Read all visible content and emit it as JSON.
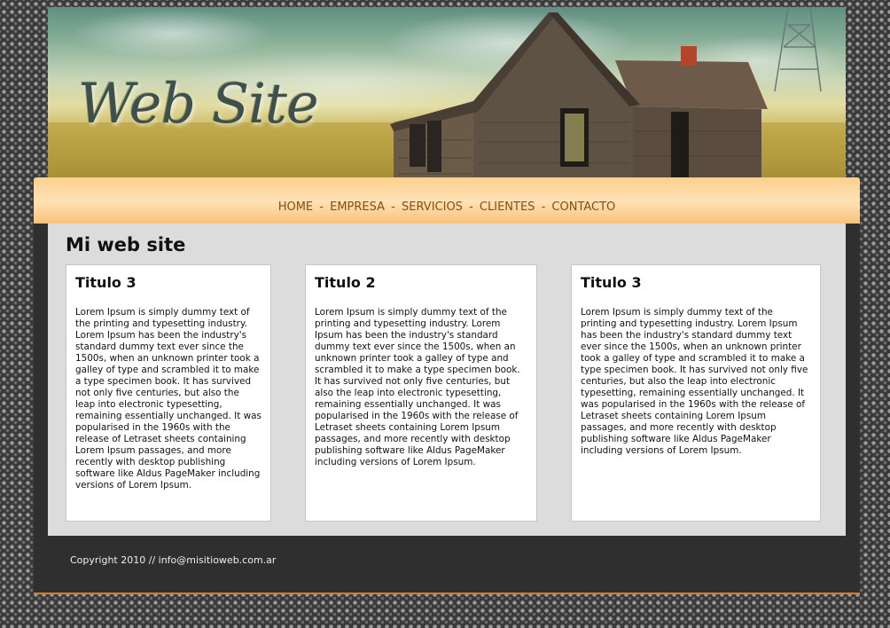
{
  "header": {
    "logo_text": "Web Site",
    "image": "abandoned-house-in-field-image"
  },
  "nav": {
    "items": [
      "HOME",
      "EMPRESA",
      "SERVICIOS",
      "CLIENTES",
      "CONTACTO"
    ],
    "separator": "-"
  },
  "main": {
    "title": "Mi web site",
    "columns": [
      {
        "heading": "Titulo 3",
        "text": "Lorem Ipsum is simply dummy text of the printing and typesetting industry. Lorem Ipsum has been the industry's standard dummy text ever since the 1500s, when an unknown printer took a galley of type and scrambled it to make a type specimen book. It has survived not only five centuries, but also the leap into electronic typesetting, remaining essentially unchanged. It was popularised in the 1960s with the release of Letraset sheets containing Lorem Ipsum passages, and more recently with desktop publishing software like Aldus PageMaker including versions of Lorem Ipsum."
      },
      {
        "heading": "Titulo 2",
        "text": "Lorem Ipsum is simply dummy text of the printing and typesetting industry. Lorem Ipsum has been the industry's standard dummy text ever since the 1500s, when an unknown printer took a galley of type and scrambled it to make a type specimen book. It has survived not only five centuries, but also the leap into electronic typesetting, remaining essentially unchanged. It was popularised in the 1960s with the release of Letraset sheets containing Lorem Ipsum passages, and more recently with desktop publishing software like Aldus PageMaker including versions of Lorem Ipsum."
      },
      {
        "heading": "Titulo 3",
        "text": "Lorem Ipsum is simply dummy text of the printing and typesetting industry. Lorem Ipsum has been the industry's standard dummy text ever since the 1500s, when an unknown printer took a galley of type and scrambled it to make a type specimen book. It has survived not only five centuries, but also the leap into electronic typesetting, remaining essentially unchanged. It was popularised in the 1960s with the release of Letraset sheets containing Lorem Ipsum passages, and more recently with desktop publishing software like Aldus PageMaker including versions of Lorem Ipsum."
      }
    ]
  },
  "footer": {
    "copyright": "Copyright 2010 // info@misitioweb.com.ar"
  },
  "colors": {
    "nav_text": "#8a4e08",
    "nav_bg": "#fbd08e",
    "main_bg": "#dcdcdc",
    "footer_bg": "#2f2f2f",
    "footer_accent": "#e07a1c"
  }
}
